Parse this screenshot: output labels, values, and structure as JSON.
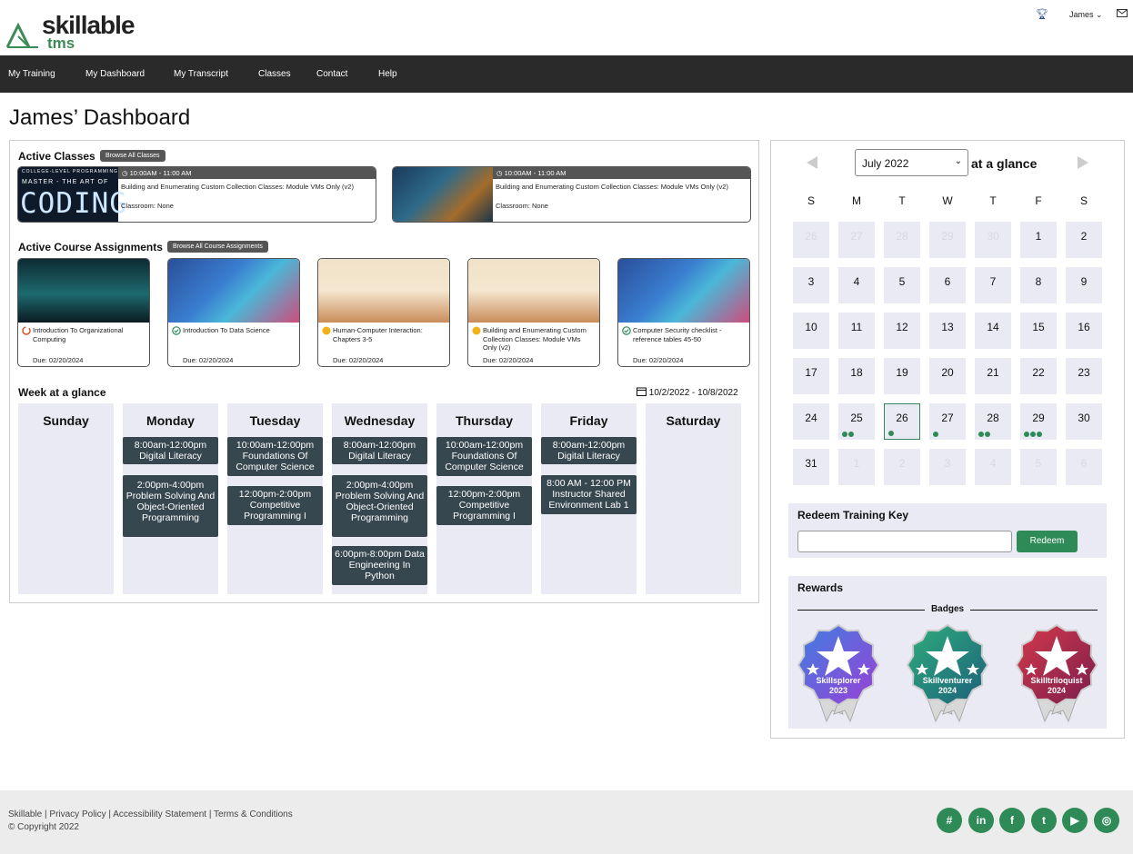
{
  "header": {
    "logo_text": "skillable",
    "logo_sub": "tms",
    "user_name": "James",
    "trophy_icon": "trophy-icon",
    "mail_icon": "mail-icon"
  },
  "nav": [
    "My Training",
    "My Dashboard",
    "My Transcript",
    "Classes",
    "Contact",
    "Help"
  ],
  "page_title": "James’ Dashboard",
  "active_classes": {
    "title": "Active Classes",
    "browse_label": "Browse All Classes",
    "items": [
      {
        "time": "10:00AM - 11:00 AM",
        "title": "Building and Enumerating Custom Collection Classes: Module VMs Only (v2)",
        "classroom": "Classroom: None",
        "thumb_top": "COLLEGE-LEVEL PROGRAMMING",
        "thumb_mid": "MASTER - THE ART OF",
        "thumb_big": "CODING"
      },
      {
        "time": "10:00AM - 11:00 AM",
        "title": "Building and Enumerating Custom Collection Classes: Module VMs Only (v2)",
        "classroom": "Classroom: None"
      }
    ]
  },
  "course_assignments": {
    "title": "Active Course Assignments",
    "browse_label": "Browse All Course Assignments",
    "items": [
      {
        "name": "Introduction To Organizational Computing",
        "due": "Due: 02/20/2024",
        "status": "in-progress"
      },
      {
        "name": "Introduction To Data Science",
        "due": "Due: 02/20/2024",
        "status": "complete"
      },
      {
        "name": "Human-Computer Interaction: Chapters 3-5",
        "due": "Due: 02/20/2024",
        "status": "new"
      },
      {
        "name": "Building and Enumerating Custom Collection Classes: Module VMs Only (v2)",
        "due": "Due: 02/20/2024",
        "status": "new"
      },
      {
        "name": "Computer Security checklist - reference tables 45-50",
        "due": "Due: 02/20/2024",
        "status": "complete"
      }
    ]
  },
  "week": {
    "title": "Week at a glance",
    "range": "10/2/2022 - 10/8/2022",
    "days": [
      {
        "name": "Sunday",
        "events": []
      },
      {
        "name": "Monday",
        "events": [
          "8:00am-12:00pm Digital Literacy",
          "2:00pm-4:00pm Problem Solving And Object-Oriented Programming"
        ]
      },
      {
        "name": "Tuesday",
        "events": [
          "10:00am-12:00pm Foundations Of Computer Science",
          "12:00pm-2:00pm Competitive Programming I"
        ]
      },
      {
        "name": "Wednesday",
        "events": [
          "8:00am-12:00pm Digital Literacy",
          "2:00pm-4:00pm Problem Solving And Object-Oriented Programming",
          "6:00pm-8:00pm Data Engineering In Python"
        ]
      },
      {
        "name": "Thursday",
        "events": [
          "10:00am-12:00pm Foundations Of Computer Science",
          "12:00pm-2:00pm Competitive Programming I"
        ]
      },
      {
        "name": "Friday",
        "events": [
          "8:00am-12:00pm Digital Literacy",
          "8:00 AM - 12:00 PM Instructor Shared Environment Lab 1"
        ]
      },
      {
        "name": "Saturday",
        "events": []
      }
    ]
  },
  "calendar": {
    "month": "July 2022",
    "glance": "at a glance",
    "weekdays": [
      "S",
      "M",
      "T",
      "W",
      "T",
      "F",
      "S"
    ],
    "cells": [
      {
        "d": "26",
        "m": true
      },
      {
        "d": "27",
        "m": true
      },
      {
        "d": "28",
        "m": true
      },
      {
        "d": "29",
        "m": true
      },
      {
        "d": "30",
        "m": true
      },
      {
        "d": "1"
      },
      {
        "d": "2"
      },
      {
        "d": "3"
      },
      {
        "d": "4"
      },
      {
        "d": "5"
      },
      {
        "d": "6"
      },
      {
        "d": "7"
      },
      {
        "d": "8"
      },
      {
        "d": "9"
      },
      {
        "d": "10"
      },
      {
        "d": "11"
      },
      {
        "d": "12"
      },
      {
        "d": "13"
      },
      {
        "d": "14"
      },
      {
        "d": "15"
      },
      {
        "d": "16"
      },
      {
        "d": "17"
      },
      {
        "d": "18"
      },
      {
        "d": "19"
      },
      {
        "d": "20"
      },
      {
        "d": "21"
      },
      {
        "d": "22"
      },
      {
        "d": "23"
      },
      {
        "d": "24"
      },
      {
        "d": "25",
        "dots": 2
      },
      {
        "d": "26",
        "dots": 1,
        "today": true
      },
      {
        "d": "27",
        "dots": 1
      },
      {
        "d": "28",
        "dots": 2
      },
      {
        "d": "29",
        "dots": 3
      },
      {
        "d": "30"
      },
      {
        "d": "31"
      },
      {
        "d": "1",
        "m": true
      },
      {
        "d": "2",
        "m": true
      },
      {
        "d": "3",
        "m": true
      },
      {
        "d": "4",
        "m": true
      },
      {
        "d": "5",
        "m": true
      },
      {
        "d": "6",
        "m": true
      }
    ]
  },
  "redeem": {
    "title": "Redeem Training Key",
    "input_value": "",
    "button_label": "Redeem"
  },
  "rewards": {
    "title": "Rewards",
    "badges_label": "Badges",
    "badges": [
      {
        "name": "Skillsplorer",
        "year": "2023",
        "colors": [
          "#3f7fe0",
          "#9b3fd6"
        ]
      },
      {
        "name": "Skillventurer",
        "year": "2024",
        "colors": [
          "#2fae7d",
          "#1b5f7a"
        ]
      },
      {
        "name": "Skilltriloquist",
        "year": "2024",
        "colors": [
          "#d43a4b",
          "#7a1d4c"
        ]
      }
    ]
  },
  "footer": {
    "links": "Skillable | Privacy Policy | Accessibility Statement | Terms & Conditions",
    "copyright": "© Copyright 2022",
    "social": [
      "slack-icon",
      "linkedin-icon",
      "facebook-icon",
      "twitter-icon",
      "youtube-icon",
      "instagram-icon"
    ]
  },
  "colors": {
    "accent": "#2e8b57",
    "nav_bg": "#2a2a2a",
    "event_bg": "#37474f",
    "panel_bg": "#eaeaf4"
  }
}
